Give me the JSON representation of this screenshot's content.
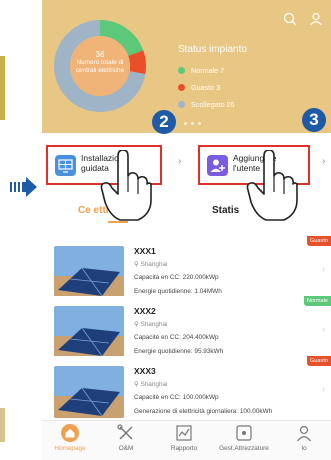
{
  "colors": {
    "accent": "#f0a050",
    "hero_bg": "#e8c684",
    "normal": "#5cc87a",
    "fault": "#e8502a",
    "disconnected": "#a0b4c8",
    "callout_border": "#e0302a",
    "callout_badge": "#1f5aa6"
  },
  "header": {
    "icons": [
      "search-icon",
      "user-icon"
    ]
  },
  "overview": {
    "total_count": "36",
    "total_label": "Numero totale di centrali elettriche",
    "status_title": "Status impianto",
    "legend": [
      {
        "label": "Normale 7",
        "value": 7,
        "color": "#5cc87a"
      },
      {
        "label": "Guasto 3",
        "value": 3,
        "color": "#e8502a"
      },
      {
        "label": "Scollegato 26",
        "value": 26,
        "color": "#a0b4c8"
      }
    ]
  },
  "callouts": {
    "badge_2": "2",
    "badge_3": "3"
  },
  "quick_actions": [
    {
      "label_line1": "Installazione",
      "label_line2": "guidata",
      "icon": "guided-install-icon",
      "chevron": "›"
    },
    {
      "label_line1": "Aggiungere",
      "label_line2": "l'utente",
      "icon": "add-user-icon",
      "chevron": "›"
    }
  ],
  "tabs": [
    {
      "label": "Ce          ettrica",
      "active": true
    },
    {
      "label": "Statis",
      "active": false
    }
  ],
  "plants": [
    {
      "name": "XXX1",
      "location": "Shanghai",
      "capacity": "Capacità en CC: 220.000kWp",
      "energy": "Energie quotidienne: 1.04MWh",
      "status": "Guasto",
      "status_color": "#e8502a"
    },
    {
      "name": "XXX2",
      "location": "Shanghai",
      "capacity": "Capacité en CC: 204.400kWp",
      "energy": "Energie quotidienne: 95.93kWh",
      "status": "Normale",
      "status_color": "#5cc87a"
    },
    {
      "name": "XXX3",
      "location": "Shanghai",
      "capacity": "Capacité en CC: 100.000kWp",
      "energy": "Generazione di elettricità giornaliera: 100.00kWh",
      "status": "Guasto",
      "status_color": "#e8502a"
    }
  ],
  "bottom_nav": [
    {
      "label": "Homepage",
      "icon": "home-icon",
      "active": true
    },
    {
      "label": "O&M",
      "icon": "tools-icon",
      "active": false
    },
    {
      "label": "Rapporto",
      "icon": "report-icon",
      "active": false
    },
    {
      "label": "Gest.Attrezzature",
      "icon": "device-icon",
      "active": false
    },
    {
      "label": "Io",
      "icon": "profile-icon",
      "active": false
    }
  ]
}
